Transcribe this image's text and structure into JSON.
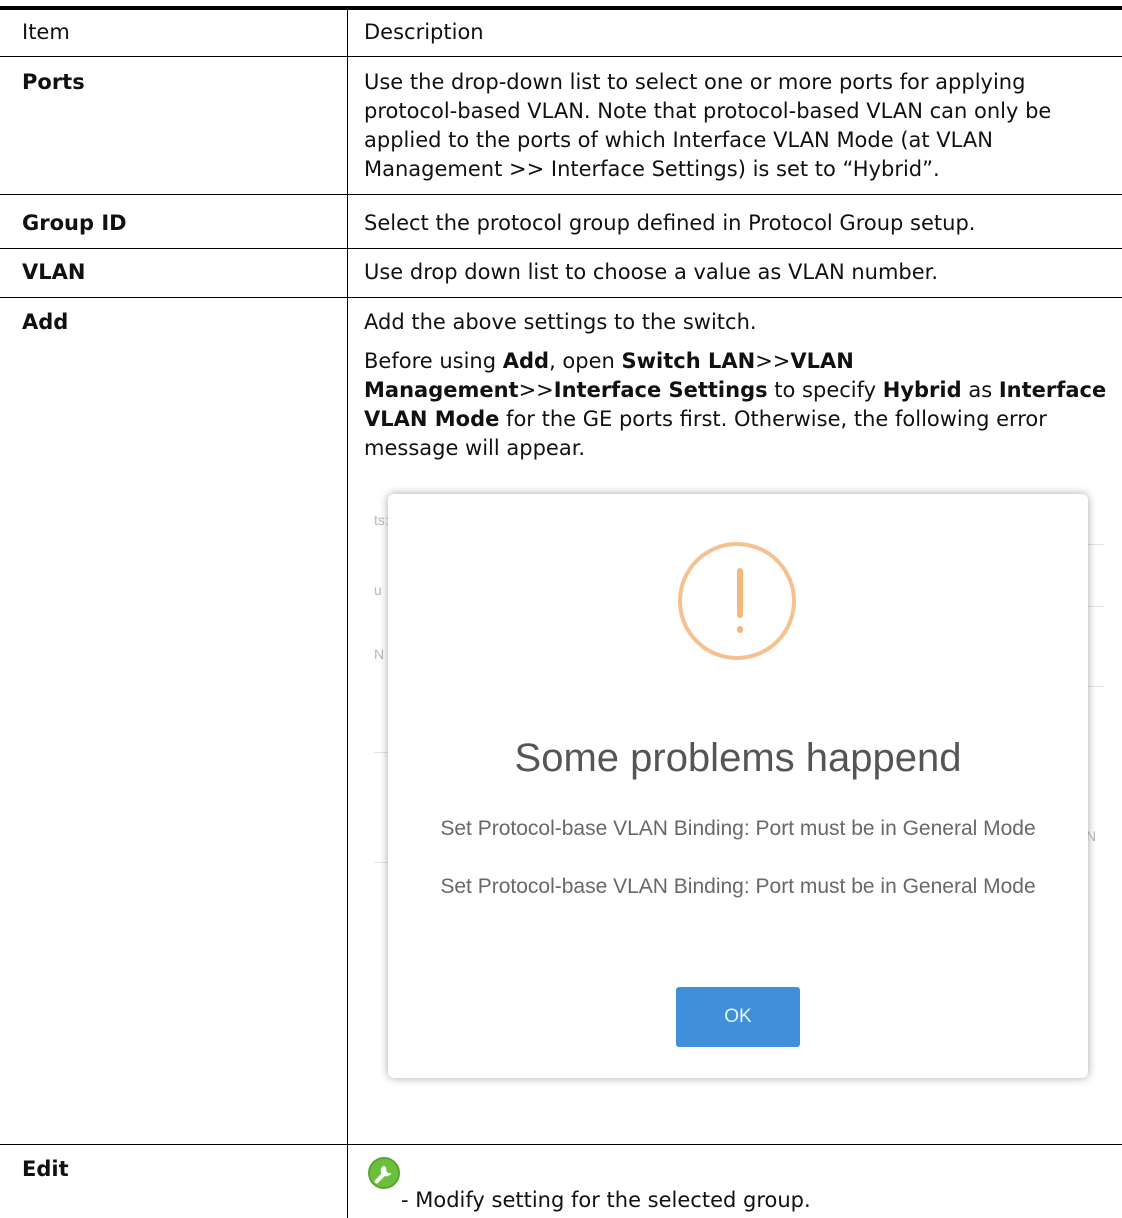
{
  "table": {
    "headers": {
      "item": "Item",
      "description": "Description"
    },
    "rows": [
      {
        "item": "Ports",
        "description": "Use the drop-down list to select one or more ports for applying protocol-based VLAN. Note that protocol-based VLAN can only be applied to the ports of which Interface VLAN Mode (at VLAN Management >> Interface Settings) is set to “Hybrid”."
      },
      {
        "item": "Group ID",
        "description": "Select the protocol group defined in Protocol Group setup."
      },
      {
        "item": "VLAN",
        "description": "Use drop down list to choose a value as VLAN number."
      },
      {
        "item": "Add",
        "description": "Add the above settings to the switch.",
        "note": {
          "t1": "Before using ",
          "b1": "Add",
          "t2": ", open ",
          "b2": "Switch LAN",
          "t3": ">>",
          "b3": "VLAN Management",
          "t4": ">>",
          "b4": "Interface Settings",
          "t5": " to specify ",
          "b5": "Hybrid",
          "t6": " as ",
          "b6": "Interface VLAN Mode",
          "t7": " for the GE ports first. Otherwise, the following error message will appear."
        },
        "screenshot": {
          "background_fragments": [
            "ts:",
            "u",
            "N",
            "N"
          ],
          "dialog": {
            "icon": "warning-exclamation-icon",
            "title": "Some problems happend",
            "messages": [
              "Set Protocol-base VLAN Binding: Port must be in General Mode",
              "Set Protocol-base VLAN Binding: Port must be in General Mode"
            ],
            "ok_label": "OK",
            "colors": {
              "warning": "#f5b77c",
              "button": "#3f8fdb"
            }
          }
        }
      },
      {
        "item": "Edit",
        "icon": "wrench-icon",
        "description": " - Modify setting for the selected group."
      }
    ]
  }
}
